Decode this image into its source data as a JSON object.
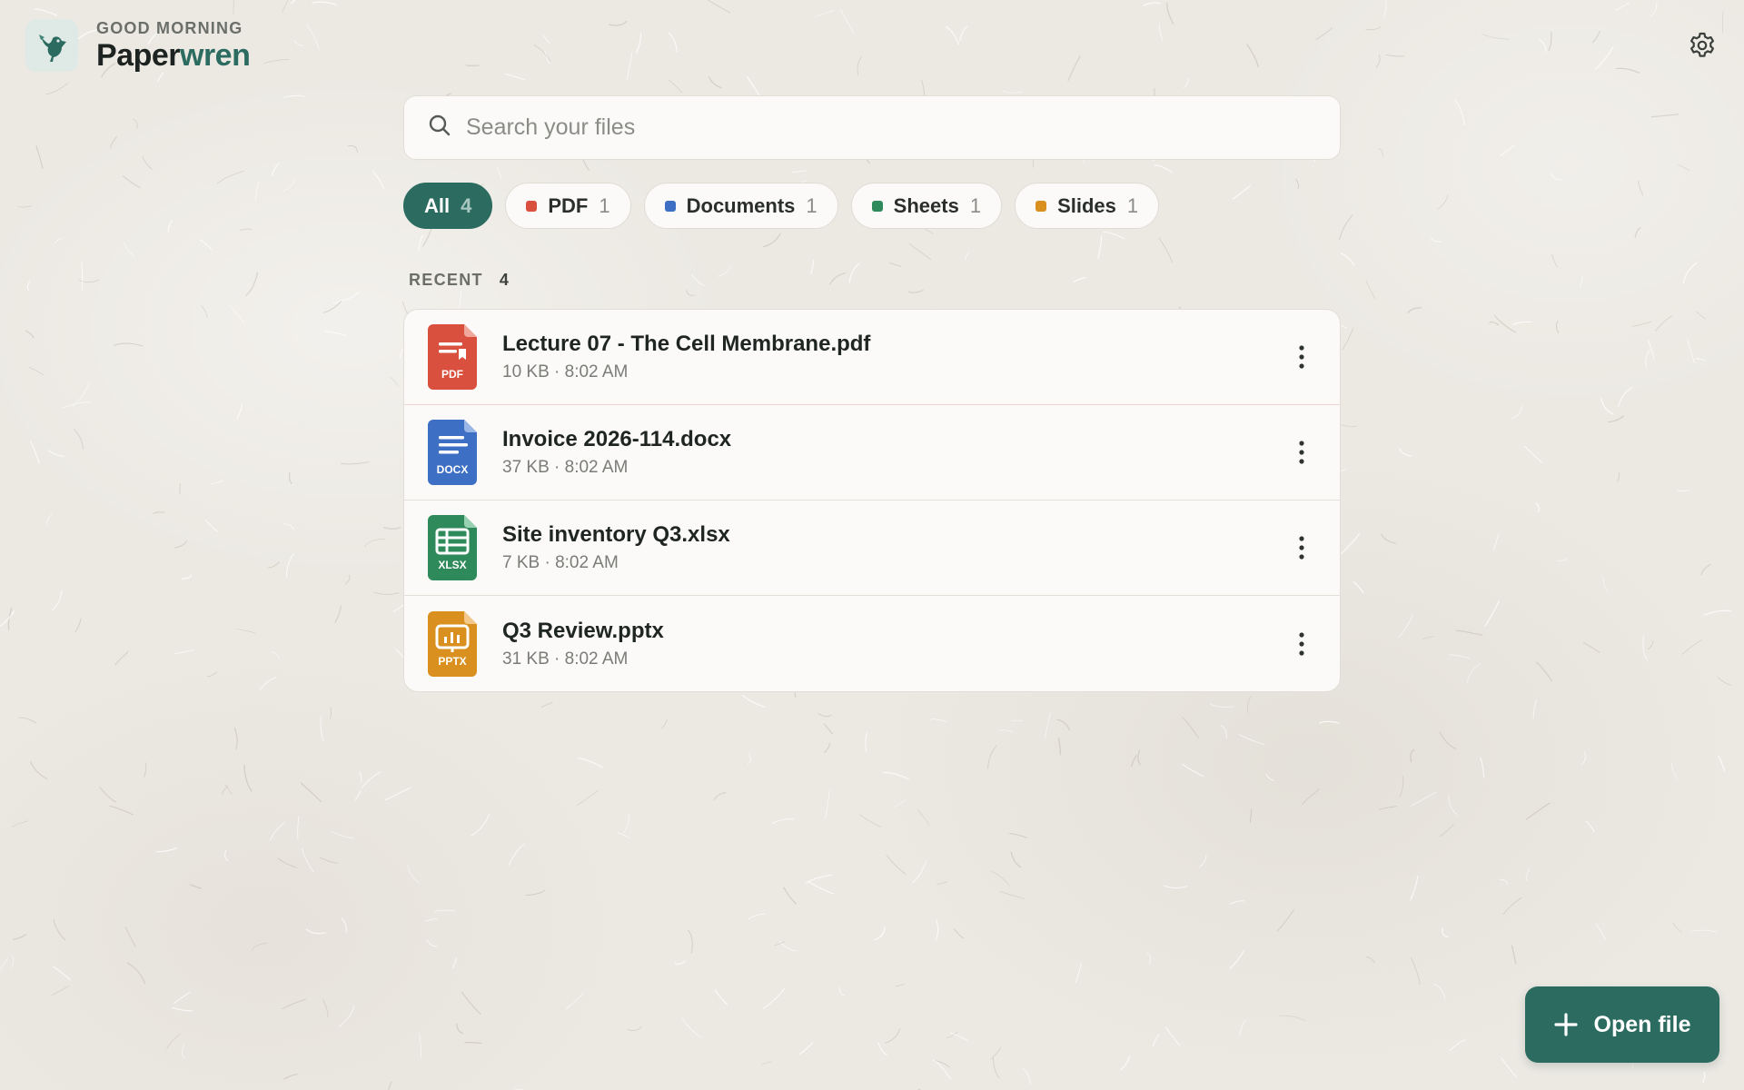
{
  "header": {
    "greeting": "GOOD MORNING",
    "app_name_part1": "Paper",
    "app_name_part2": "wren",
    "logo_icon": "bird-icon",
    "settings_icon": "gear-icon"
  },
  "search": {
    "placeholder": "Search your files",
    "value": ""
  },
  "filters": [
    {
      "label": "All",
      "count": "4",
      "active": true
    },
    {
      "label": "PDF",
      "count": "1",
      "color": "#d9503f"
    },
    {
      "label": "Documents",
      "count": "1",
      "color": "#3d6fc4"
    },
    {
      "label": "Sheets",
      "count": "1",
      "color": "#2e8a5a"
    },
    {
      "label": "Slides",
      "count": "1",
      "color": "#d9901f"
    }
  ],
  "recent": {
    "label": "RECENT",
    "count": "4"
  },
  "files": [
    {
      "name": "Lecture 07 - The Cell Membrane.pdf",
      "meta": "10 KB · 8:02 AM",
      "type": "PDF",
      "color": "#d9503f"
    },
    {
      "name": "Invoice 2026-114.docx",
      "meta": "37 KB · 8:02 AM",
      "type": "DOCX",
      "color": "#3d6fc4"
    },
    {
      "name": "Site inventory Q3.xlsx",
      "meta": "7 KB · 8:02 AM",
      "type": "XLSX",
      "color": "#2e8a5a"
    },
    {
      "name": "Q3 Review.pptx",
      "meta": "31 KB · 8:02 AM",
      "type": "PPTX",
      "color": "#d9901f"
    }
  ],
  "fab": {
    "label": "Open file",
    "icon": "plus-icon"
  },
  "colors": {
    "accent": "#2b6b60",
    "background": "#ece9e3"
  }
}
